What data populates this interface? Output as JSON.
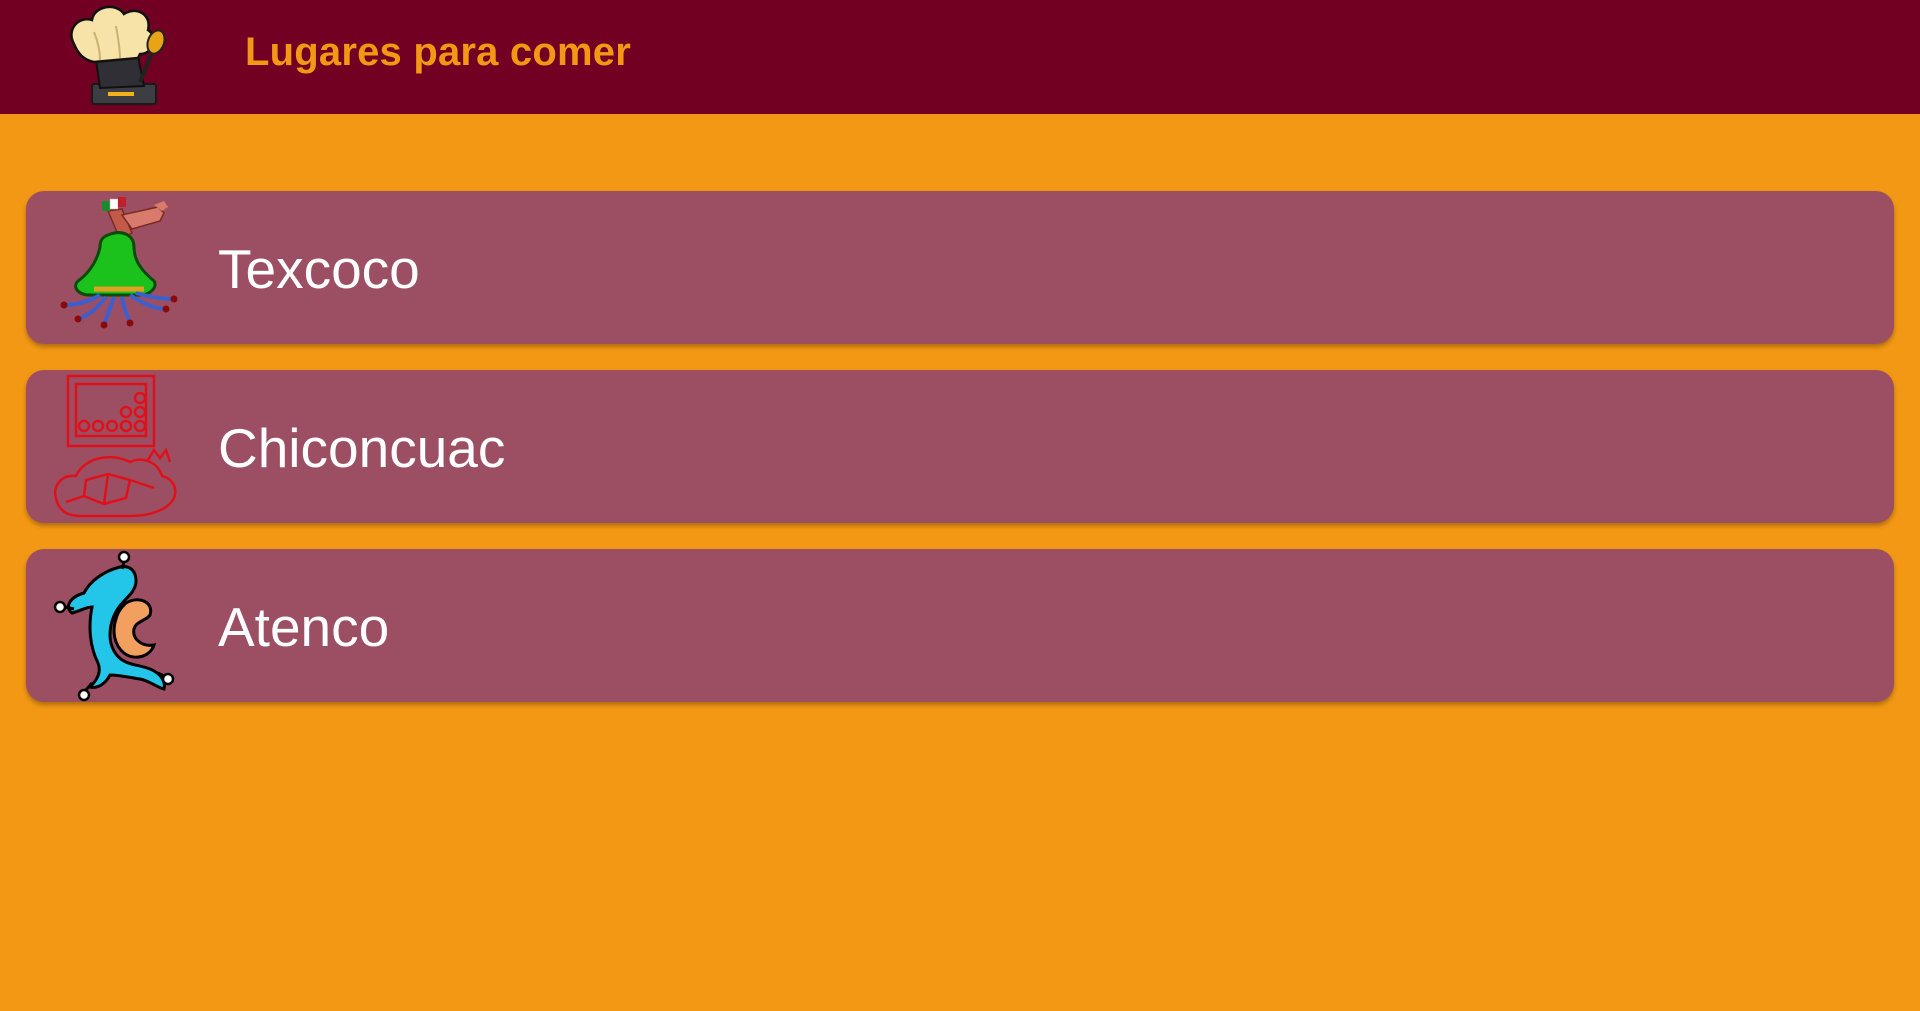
{
  "appbar": {
    "title": "Lugares para comer",
    "logo_icon": "chef-hat-spoon-icon",
    "background": "#710022",
    "title_color": "#F39814"
  },
  "page": {
    "background": "#F39814"
  },
  "places": [
    {
      "label": "Texcoco",
      "icon": "texcoco-glyph-icon"
    },
    {
      "label": "Chiconcuac",
      "icon": "chiconcuac-glyph-icon"
    },
    {
      "label": "Atenco",
      "icon": "atenco-glyph-icon"
    }
  ],
  "card_color": "#9C4F62"
}
